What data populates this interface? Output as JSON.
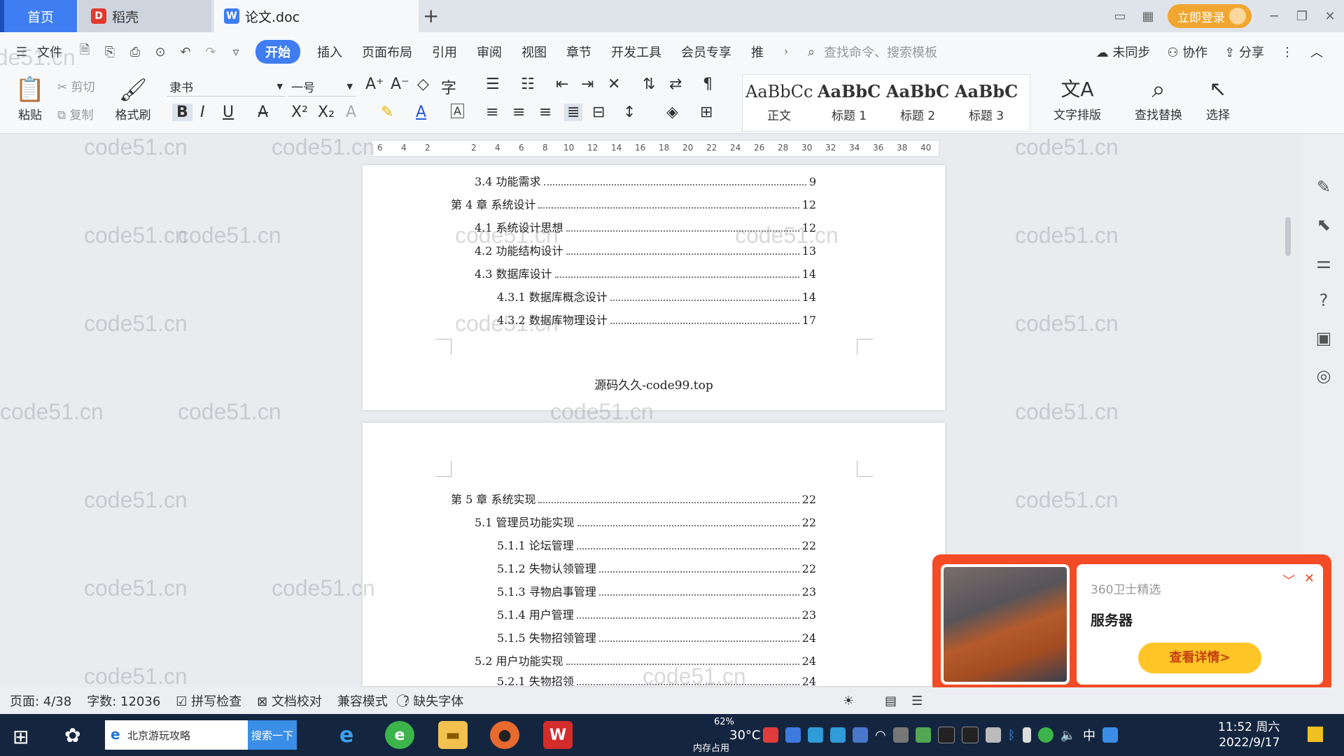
{
  "tabs": {
    "home": "首页",
    "daoke": "稻壳",
    "doc": "论文.doc",
    "add": "+"
  },
  "title_right": {
    "login": "立即登录"
  },
  "menu": {
    "file": "文件",
    "items": [
      "开始",
      "插入",
      "页面布局",
      "引用",
      "审阅",
      "视图",
      "章节",
      "开发工具",
      "会员专享",
      "推"
    ],
    "search_cmd": "查找命令、搜索模板",
    "unsynced": "未同步",
    "collab": "协作",
    "share": "分享"
  },
  "ribbon": {
    "paste": "粘贴",
    "cut": "剪切",
    "copy": "复制",
    "format_painter": "格式刷",
    "font": "隶书",
    "size": "一号",
    "styles": [
      {
        "sample": "AaBbCcI",
        "name": "正文"
      },
      {
        "sample": "AaBbC",
        "name": "标题 1"
      },
      {
        "sample": "AaBbC",
        "name": "标题 2"
      },
      {
        "sample": "AaBbC",
        "name": "标题 3"
      }
    ],
    "text_layout": "文字排版",
    "find_replace": "查找替换",
    "select": "选择"
  },
  "ruler_ticks": [
    "6",
    "4",
    "2",
    "2",
    "4",
    "6",
    "8",
    "10",
    "12",
    "14",
    "16",
    "18",
    "20",
    "22",
    "24",
    "26",
    "28",
    "30",
    "32",
    "34",
    "36",
    "38",
    "40"
  ],
  "page1": {
    "toc": [
      {
        "text": "3.4 功能需求",
        "page": "9",
        "level": 2
      },
      {
        "text": "第 4 章  系统设计",
        "page": "12",
        "level": 1
      },
      {
        "text": "4.1 系统设计思想",
        "page": "12",
        "level": 2
      },
      {
        "text": "4.2 功能结构设计",
        "page": "13",
        "level": 2
      },
      {
        "text": "4.3 数据库设计",
        "page": "14",
        "level": 2
      },
      {
        "text": "4.3.1  数据库概念设计",
        "page": "14",
        "level": 3
      },
      {
        "text": "4.3.2  数据库物理设计",
        "page": "17",
        "level": 3
      }
    ],
    "footer": "源码久久-code99.top"
  },
  "page2": {
    "toc": [
      {
        "text": "第 5 章  系统实现",
        "page": "22",
        "level": 1
      },
      {
        "text": "5.1 管理员功能实现",
        "page": "22",
        "level": 2
      },
      {
        "text": "5.1.1  论坛管理",
        "page": "22",
        "level": 3
      },
      {
        "text": "5.1.2  失物认领管理",
        "page": "22",
        "level": 3
      },
      {
        "text": "5.1.3  寻物启事管理",
        "page": "23",
        "level": 3
      },
      {
        "text": "5.1.4  用户管理",
        "page": "23",
        "level": 3
      },
      {
        "text": "5.1.5  失物招领管理",
        "page": "24",
        "level": 3
      },
      {
        "text": "5.2 用户功能实现",
        "page": "24",
        "level": 2
      },
      {
        "text": "5.2.1  失物招领",
        "page": "24",
        "level": 3
      }
    ]
  },
  "watermark": "code51.cn",
  "popup": {
    "source": "360卫士精选",
    "title": "服务器",
    "button": "查看详情>"
  },
  "status": {
    "page": "页面: 4/38",
    "words": "字数: 12036",
    "spell": "拼写检查",
    "proof": "文档校对",
    "compat": "兼容模式",
    "missing_font": "缺失字体"
  },
  "taskbar": {
    "search_text": "北京游玩攻略",
    "search_btn": "搜索一下",
    "weather": "30°C",
    "mem": "62%",
    "mem_label": "内存占用",
    "ime": "中",
    "time": "11:52 周六",
    "date": "2022/9/17"
  },
  "colors": {
    "accent": "#3f7ef2",
    "login": "#f0a630",
    "popup": "#f24b25",
    "taskbar": "#14263f"
  }
}
